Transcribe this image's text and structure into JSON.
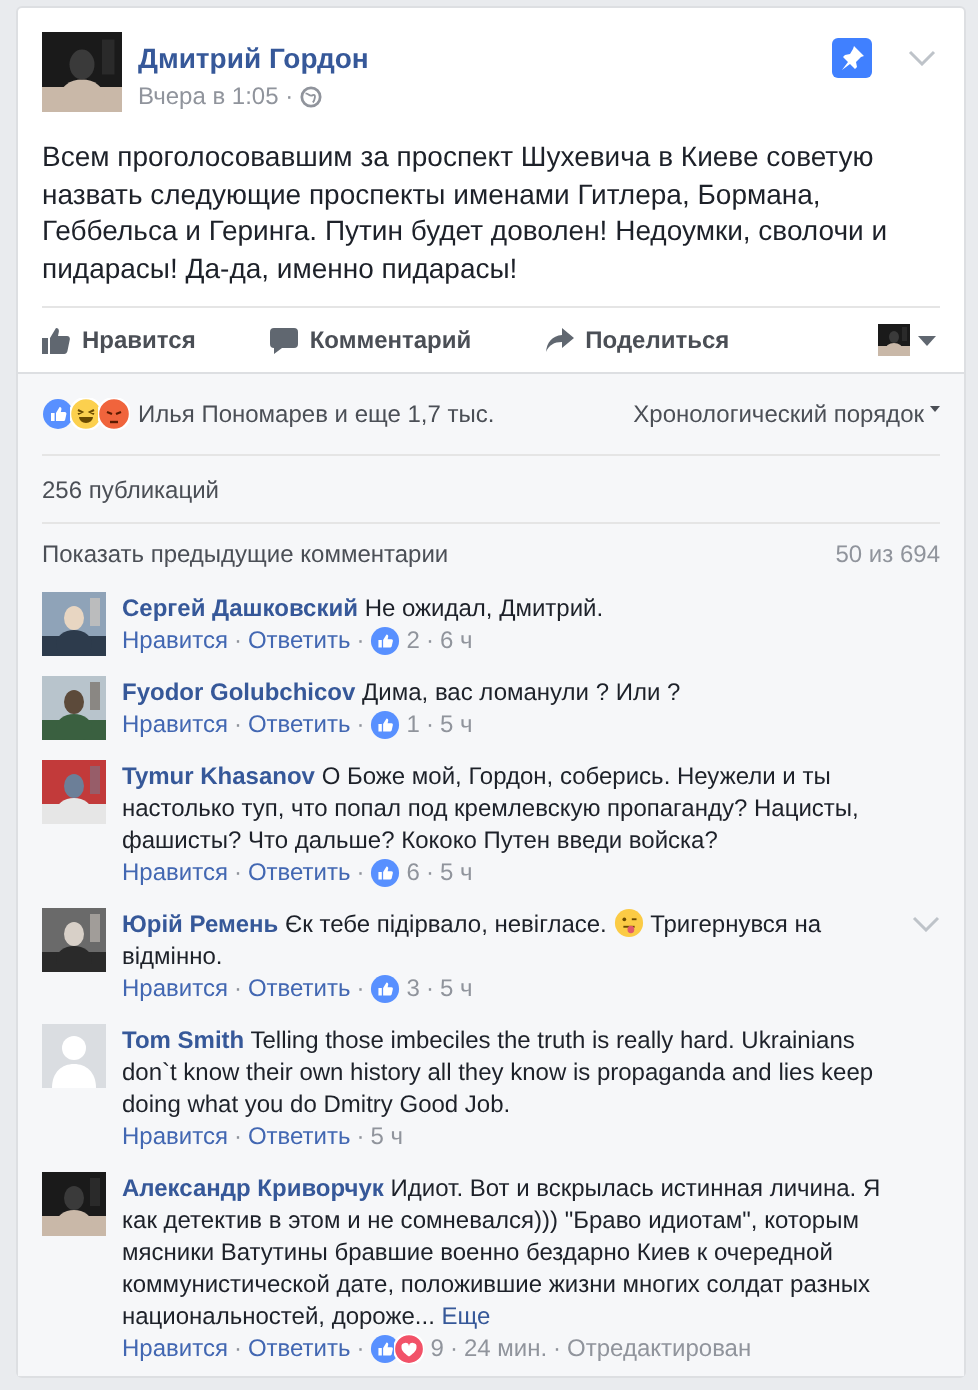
{
  "post": {
    "author": "Дмитрий Гордон",
    "time": "Вчера в 1:05 ·",
    "pinned": true,
    "text": "Всем проголосовавшим за проспект Шухевича в Киеве советую назвать следующие проспекты именами Гитлера, Бормана, Геббельса и Геринга. Путин будет доволен! Недоумки, сволочи и пидарасы! Да-да, именно пидарасы!",
    "actions": [
      {
        "kind": "like",
        "label": "Нравится"
      },
      {
        "kind": "comment",
        "label": "Комментарий"
      },
      {
        "kind": "share",
        "label": "Поделиться"
      }
    ]
  },
  "reactions": {
    "kinds": [
      {
        "kind": "like"
      },
      {
        "kind": "haha"
      },
      {
        "kind": "angry"
      }
    ],
    "text": "Илья Пономарев и еще 1,7 тыс."
  },
  "sort": "Хронологический порядок",
  "shares": "256 публикаций",
  "show_previous": "Показать предыдущие комментарии",
  "count": "50 из 694",
  "separator": "·",
  "comments": [
    {
      "author": "Сергей Дашковский",
      "avatar": {
        "kind": "picture"
      },
      "segments": [
        {
          "kind": "text",
          "text": "Не ожидал, Дмитрий."
        }
      ],
      "like": "Нравится",
      "reply": "Ответить",
      "reactions": [
        {
          "kind": "like"
        }
      ],
      "reaction_count": "2",
      "time": "6 ч"
    },
    {
      "author": "Fyodor Golubchicov",
      "avatar": {
        "kind": "picture"
      },
      "segments": [
        {
          "kind": "text",
          "text": "Дима, вас ломанули ? Или ?"
        }
      ],
      "like": "Нравится",
      "reply": "Ответить",
      "reactions": [
        {
          "kind": "like"
        }
      ],
      "reaction_count": "1",
      "time": "5 ч"
    },
    {
      "author": "Tymur Khasanov",
      "avatar": {
        "kind": "picture"
      },
      "segments": [
        {
          "kind": "text",
          "text": "О Боже мой, Гордон, соберись. Неужели и ты настолько туп, что попал под кремлевскую пропаганду? Нацисты, фашисты? Что дальше? Кококо Путен введи войска?"
        }
      ],
      "like": "Нравится",
      "reply": "Ответить",
      "reactions": [
        {
          "kind": "like"
        }
      ],
      "reaction_count": "6",
      "time": "5 ч"
    },
    {
      "author": "Юрій Ремень",
      "avatar": {
        "kind": "picture"
      },
      "menu": true,
      "segments": [
        {
          "kind": "text",
          "text": "Єк тебе підірвало, невігласе. "
        },
        {
          "kind": "emoji"
        },
        {
          "kind": "text",
          "text": " Тригернувся на відмінно."
        }
      ],
      "like": "Нравится",
      "reply": "Ответить",
      "reactions": [
        {
          "kind": "like"
        }
      ],
      "reaction_count": "3",
      "time": "5 ч"
    },
    {
      "author": "Tom Smith",
      "avatar": {
        "kind": "silhouette"
      },
      "segments": [
        {
          "kind": "text",
          "text": "Telling those imbeciles the truth is really hard. Ukrainians don`t know their own history all they know is propaganda and lies keep doing what you do Dmitry Good Job."
        }
      ],
      "like": "Нравится",
      "reply": "Ответить",
      "time": "5 ч"
    },
    {
      "author": "Александр Криворчук",
      "avatar": {
        "kind": "picture"
      },
      "segments": [
        {
          "kind": "text",
          "text": "Идиот. Вот и вскрылась истинная личина. Я как детектив в этом и не сомневался))) \"Браво идиотам\", которым мясники Ватутины бравшие военно бездарно Киев к очередной коммунистической дате, положившие жизни многих солдат разных национальностей, дороже..."
        },
        {
          "kind": "more",
          "text": "Еще"
        }
      ],
      "like": "Нравится",
      "reply": "Ответить",
      "reactions": [
        {
          "kind": "like"
        },
        {
          "kind": "love"
        }
      ],
      "reaction_count": "9",
      "time": "24 мин.",
      "edited": "Отредактирован"
    }
  ]
}
